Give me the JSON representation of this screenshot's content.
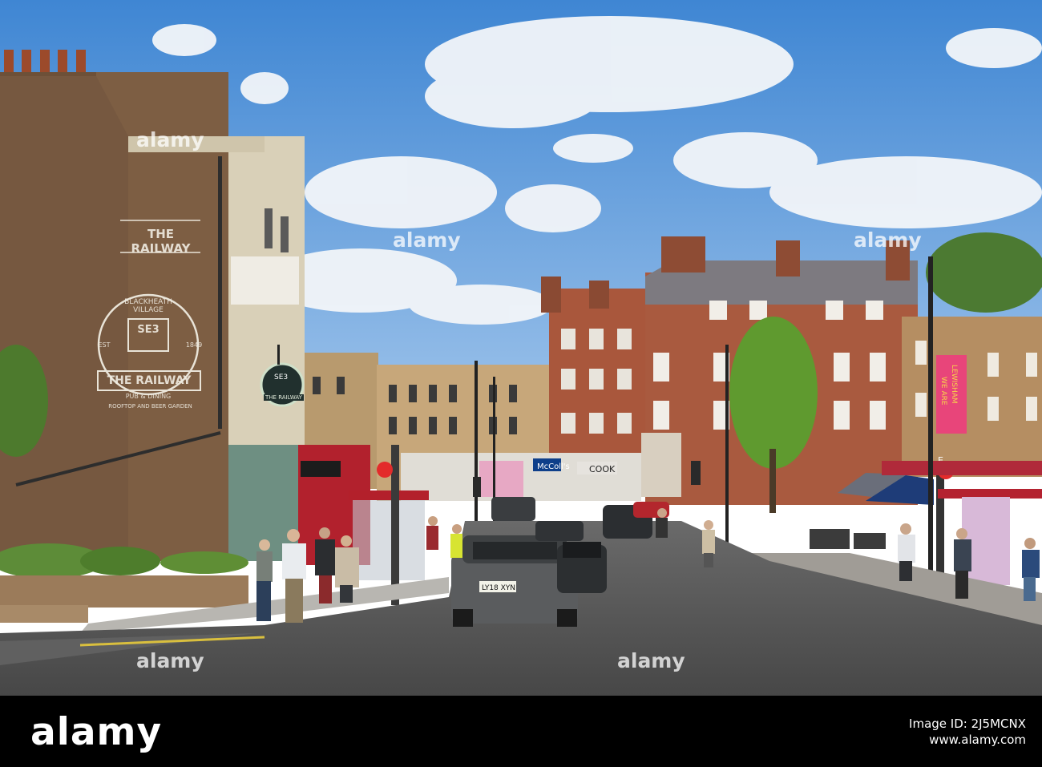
{
  "watermarks": [
    "alamy",
    "alamy",
    "alamy",
    "alamy",
    "alamy"
  ],
  "banner": {
    "brand": "alamy",
    "image_id_line": "Image ID: 2J5MCNX",
    "site": "www.alamy.com"
  },
  "signage": {
    "mural_top": "BLACKHEATH VILLAGE",
    "mural_code": "SE3",
    "mural_est": "EST",
    "mural_year": "1849",
    "mural_name": "THE RAILWAY",
    "mural_sub": "PUB & DINING",
    "mural_garden": "ROOFTOP AND BEER GARDEN",
    "pub_sign_code": "SE3",
    "pub_sign_name": "THE RAILWAY",
    "shop_mccolls": "McColl's",
    "shop_cook": "COOK",
    "banner_we_are": "WE ARE",
    "banner_lewisham": "LEWISHAM",
    "number_plate_1": "LY18 XYN",
    "bus_stop_letter": "E"
  },
  "colors": {
    "sky": "#4f8fd6",
    "brick": "#7a5a40",
    "red_brick": "#a4533a",
    "road": "#545454",
    "banner_pink": "#e8457a"
  }
}
